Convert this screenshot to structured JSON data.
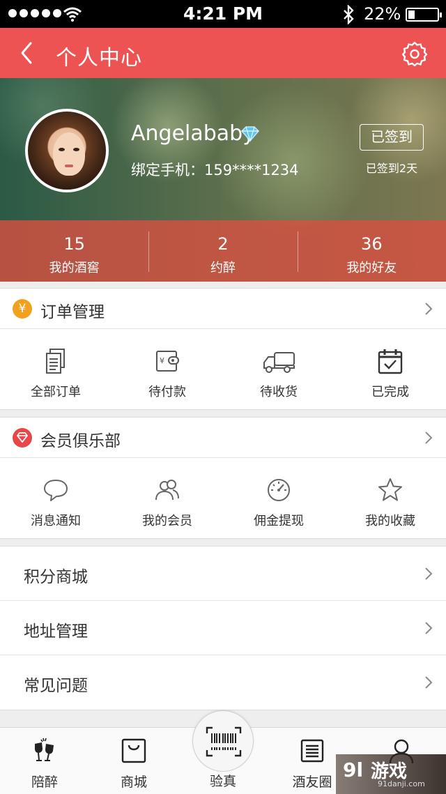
{
  "status_bar": {
    "time": "4:21 PM",
    "battery_percent": "22%",
    "battery_level": 0.22,
    "signal_bars": 5,
    "icons": [
      "signal-dots",
      "wifi-icon",
      "bluetooth-icon",
      "battery-icon"
    ]
  },
  "header": {
    "title": "个人中心",
    "back_icon": "chevron-left-icon",
    "settings_icon": "gear-icon",
    "background_color": "#ee5353"
  },
  "profile": {
    "username": "Angelababy",
    "phone_label": "绑定手机：159****1234",
    "sign_button": "已签到",
    "sign_note": "已签到2天",
    "vip_icon": "diamond-icon"
  },
  "stats": [
    {
      "value": "15",
      "label": "我的酒窖"
    },
    {
      "value": "2",
      "label": "约醉"
    },
    {
      "value": "36",
      "label": "我的好友"
    }
  ],
  "orders": {
    "title": "订单管理",
    "badge": "¥",
    "badge_color": "#f0a21e",
    "items": [
      {
        "label": "全部订单",
        "icon": "documents-icon"
      },
      {
        "label": "待付款",
        "icon": "wallet-icon"
      },
      {
        "label": "待收货",
        "icon": "truck-icon"
      },
      {
        "label": "已完成",
        "icon": "calendar-check-icon"
      }
    ]
  },
  "club": {
    "title": "会员俱乐部",
    "badge_color": "#e8474a",
    "items": [
      {
        "label": "消息通知",
        "icon": "chat-bubble-icon"
      },
      {
        "label": "我的会员",
        "icon": "users-icon"
      },
      {
        "label": "佣金提现",
        "icon": "speedometer-icon"
      },
      {
        "label": "我的收藏",
        "icon": "star-icon"
      }
    ]
  },
  "list": [
    {
      "label": "积分商城"
    },
    {
      "label": "地址管理"
    },
    {
      "label": "常见问题"
    }
  ],
  "tabbar": {
    "tabs": [
      {
        "label": "陪醉",
        "icon": "wine-glasses-icon"
      },
      {
        "label": "商城",
        "icon": "shopping-bag-icon"
      },
      {
        "label": "验真",
        "icon": "barcode-scan-icon"
      },
      {
        "label": "酒友圈",
        "icon": "list-icon"
      },
      {
        "label": "",
        "icon": "user-icon"
      }
    ]
  },
  "watermark": {
    "logo": "9l",
    "title": "游戏",
    "url": "91danji.com"
  }
}
